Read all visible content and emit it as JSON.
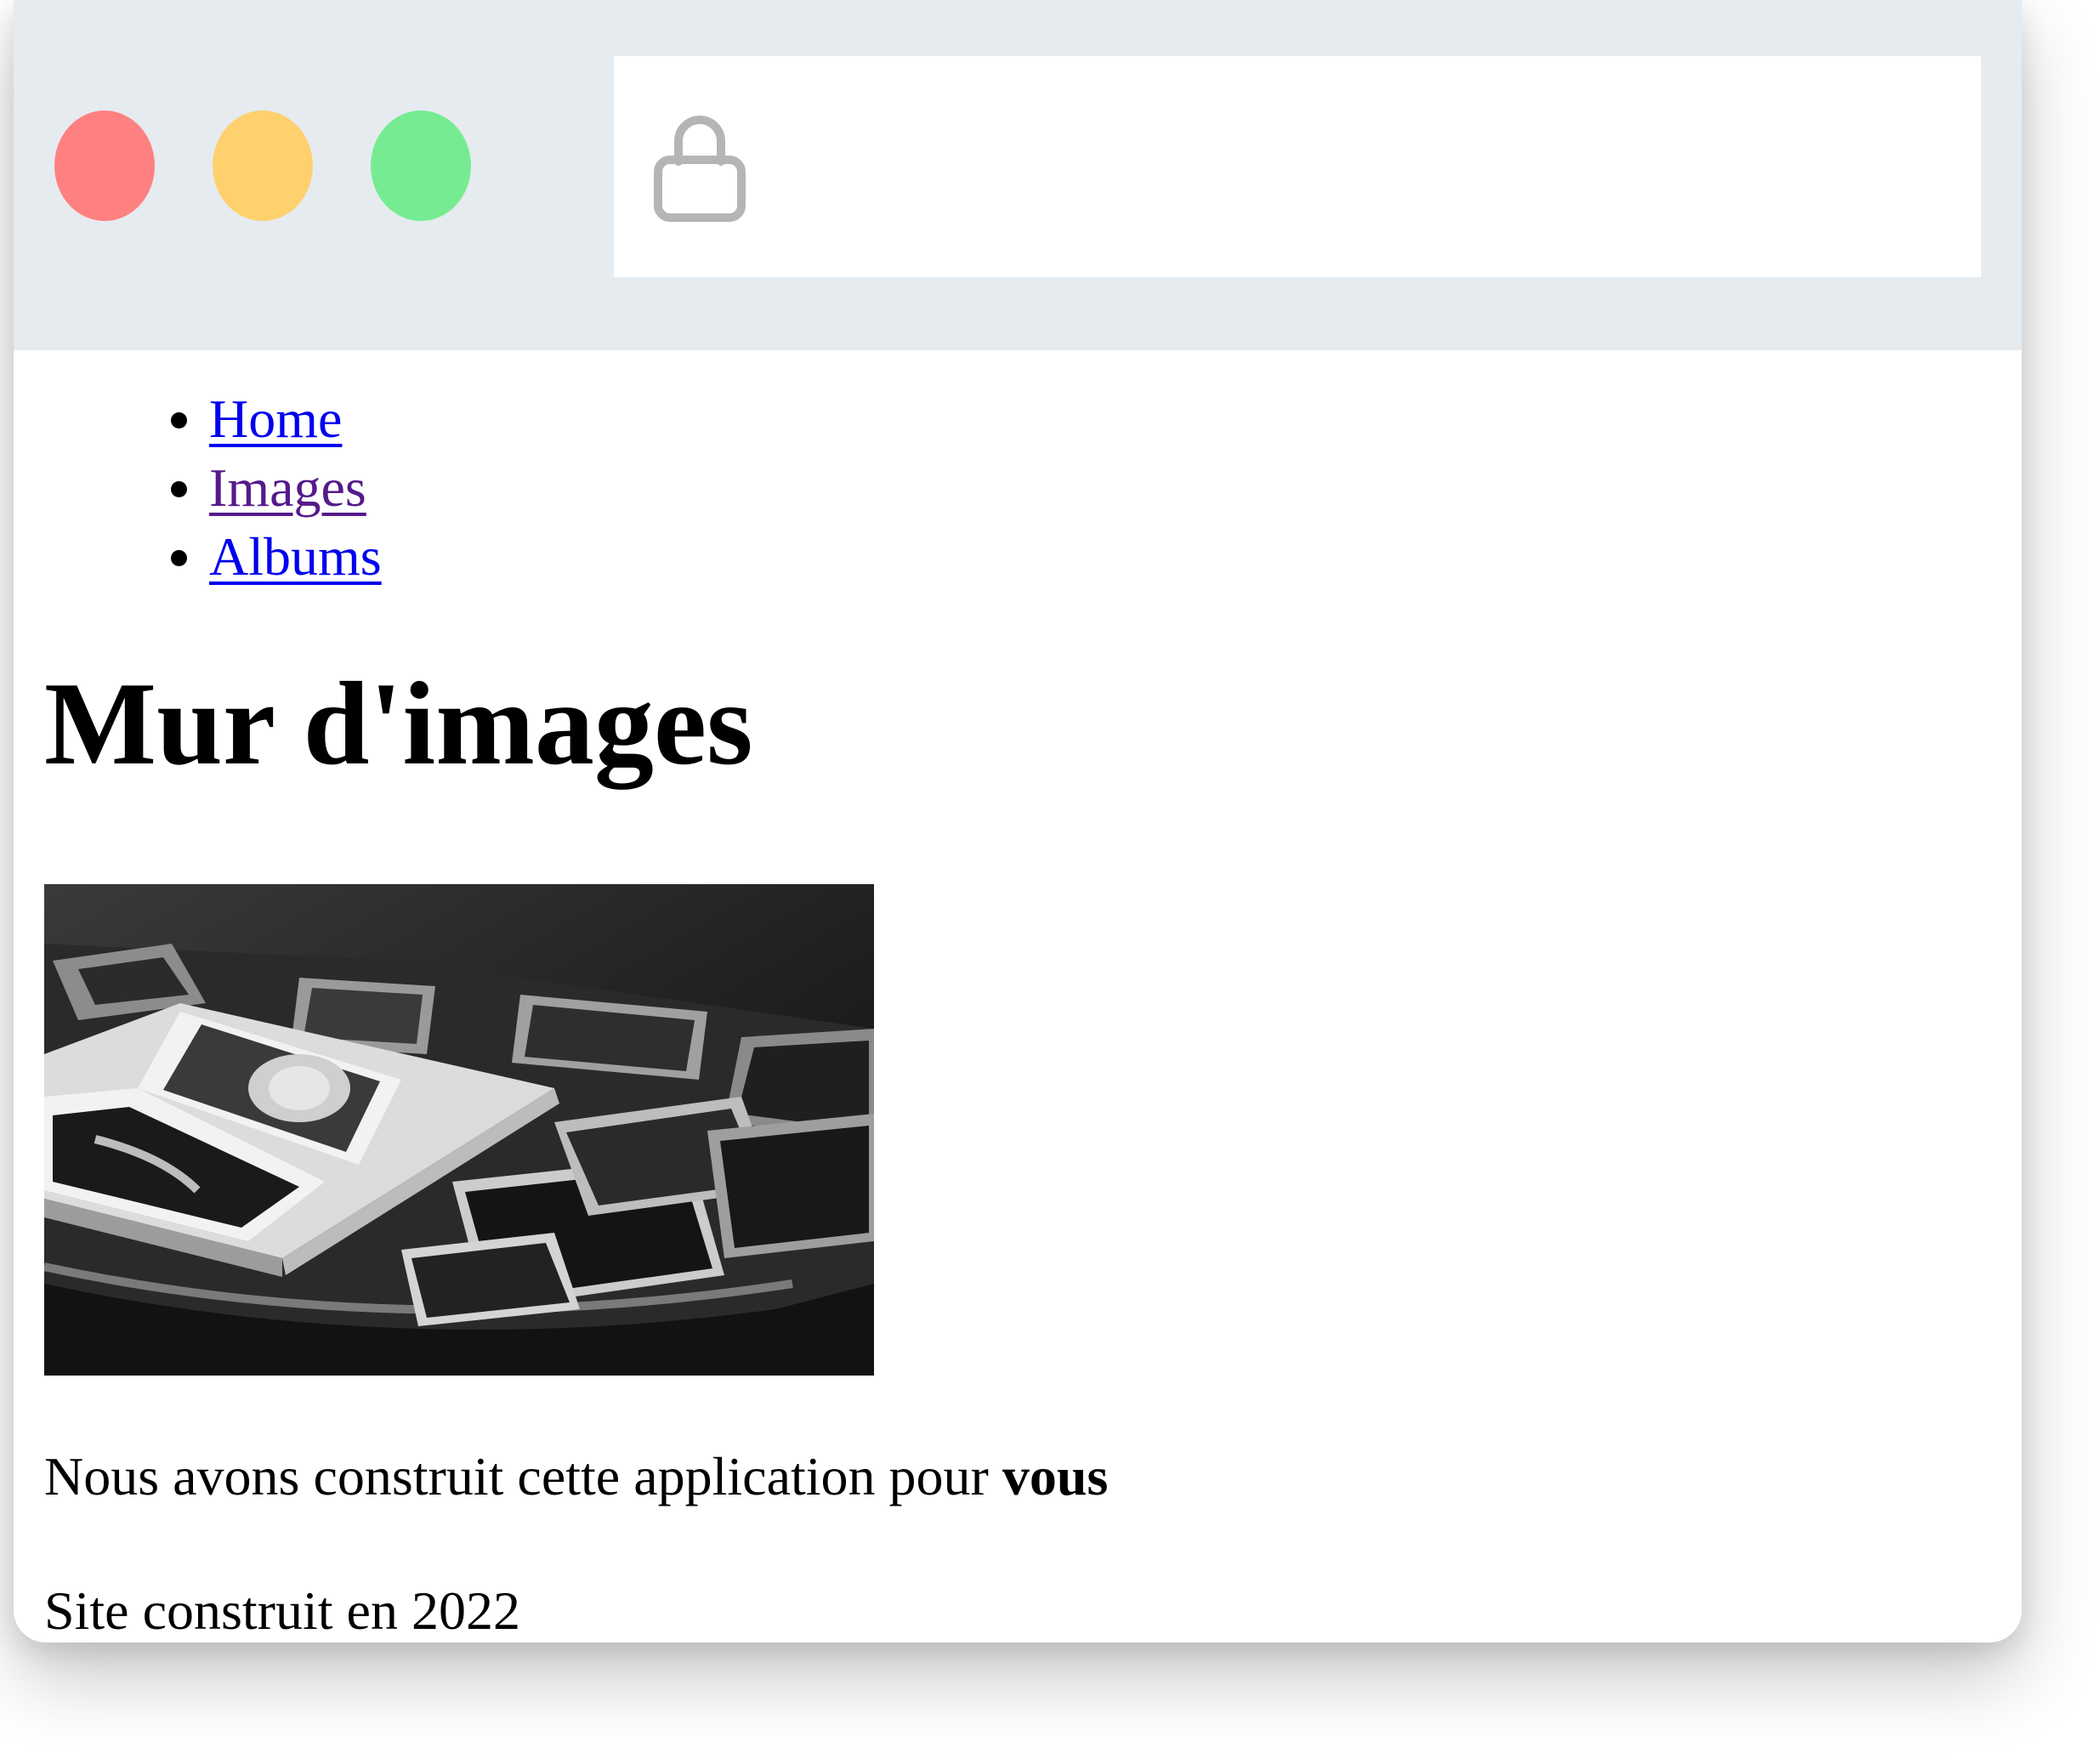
{
  "window": {
    "controls": [
      {
        "name": "close",
        "color": "#ff8080"
      },
      {
        "name": "minimize",
        "color": "#ffd06e"
      },
      {
        "name": "maximize",
        "color": "#76ec92"
      }
    ],
    "address_bar": {
      "icon": "lock-icon",
      "url": ""
    }
  },
  "nav": {
    "items": [
      {
        "label": "Home",
        "link_color": "#0000ee"
      },
      {
        "label": "Images",
        "link_color": "#551a8b"
      },
      {
        "label": "Albums",
        "link_color": "#0000ee"
      }
    ]
  },
  "main": {
    "title": "Mur d'images",
    "image": {
      "content": "black and white photo of a photo album with scattered prints"
    },
    "tagline_prefix": "Nous avons construit cette application pour ",
    "tagline_emphasis": "vous",
    "footer": "Site construit en 2022"
  }
}
